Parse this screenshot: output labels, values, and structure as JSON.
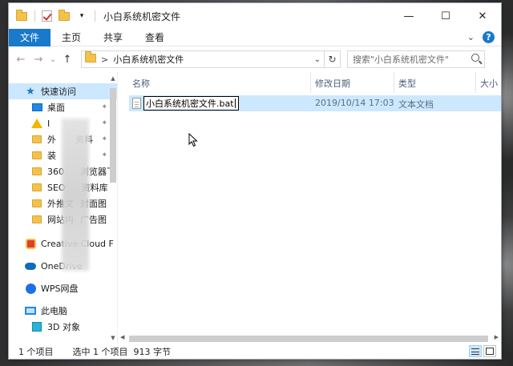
{
  "window": {
    "title": "小白系统机密文件",
    "controls": {
      "minimize": "—",
      "maximize": "☐",
      "close": "✕"
    }
  },
  "ribbon": {
    "tabs": [
      "文件",
      "主页",
      "共享",
      "查看"
    ],
    "expand": "⌄",
    "help": "?"
  },
  "address": {
    "back": "←",
    "forward": "→",
    "recent": "⌄",
    "up": "↑",
    "chevron": ">",
    "path": "小白系统机密文件",
    "dropdown": "⌄",
    "refresh": "↻",
    "search_placeholder": "搜索\"小白系统机密文件\""
  },
  "nav": {
    "items": [
      {
        "label": "快速访问",
        "icon": "star-icon"
      },
      {
        "label": "桌面",
        "icon": "desktop-icon",
        "pinned": true
      },
      {
        "label": "I",
        "icon": "warning-icon",
        "pinned": true
      },
      {
        "label": "外",
        "tail": "资料",
        "icon": "folder-icon",
        "pinned": true
      },
      {
        "label": "装",
        "icon": "folder-icon",
        "pinned": true
      },
      {
        "label": "360",
        "tail": "浏览器下",
        "icon": "folder-icon"
      },
      {
        "label": "SEO",
        "tail": "资料库",
        "icon": "folder-icon"
      },
      {
        "label": "外推文",
        "tail": "封面图",
        "icon": "folder-icon"
      },
      {
        "label": "网站内",
        "tail": "广告图",
        "icon": "folder-icon"
      },
      {
        "label": "Creative Cloud F",
        "icon": "creative-cloud-icon"
      },
      {
        "label": "OneDrive",
        "icon": "onedrive-icon"
      },
      {
        "label": "WPS网盘",
        "icon": "wps-icon"
      },
      {
        "label": "此电脑",
        "icon": "computer-icon"
      },
      {
        "label": "3D 对象",
        "icon": "3d-objects-icon"
      }
    ],
    "pin_glyph": "✦"
  },
  "columns": {
    "name": "名称",
    "modified": "修改日期",
    "type": "类型",
    "size": "大小"
  },
  "files": [
    {
      "name": "小白系统机密文件.bat",
      "modified": "2019/10/14 17:03",
      "type": "文本文档"
    }
  ],
  "status": {
    "count": "1 个项目",
    "selection": "选中 1 个项目  913 字节"
  }
}
